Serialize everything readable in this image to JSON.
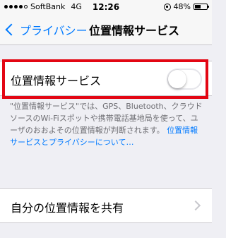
{
  "status_bar": {
    "carrier": "SoftBank",
    "network": "4G",
    "time": "12:26",
    "battery_percent": "48%",
    "battery_level": 0.48,
    "signal_bars_filled": 4,
    "signal_bars_total": 5
  },
  "nav": {
    "back_label": "プライバシー",
    "title": "位置情報サービス"
  },
  "location_services": {
    "label": "位置情報サービス",
    "toggle_on": false,
    "highlight_color": "#e30613"
  },
  "footer": {
    "text": "\"位置情報サービス\"では、GPS、Bluetooth、クラウドソースのWi-Fiスポットや携帯電話基地局を使って、ユーザのおおよその位置情報が判断されます。",
    "link": "位置情報サービスとプライバシーについて…"
  },
  "share_location": {
    "label": "自分の位置情報を共有"
  },
  "colors": {
    "accent": "#007aff",
    "background": "#efeff4"
  }
}
